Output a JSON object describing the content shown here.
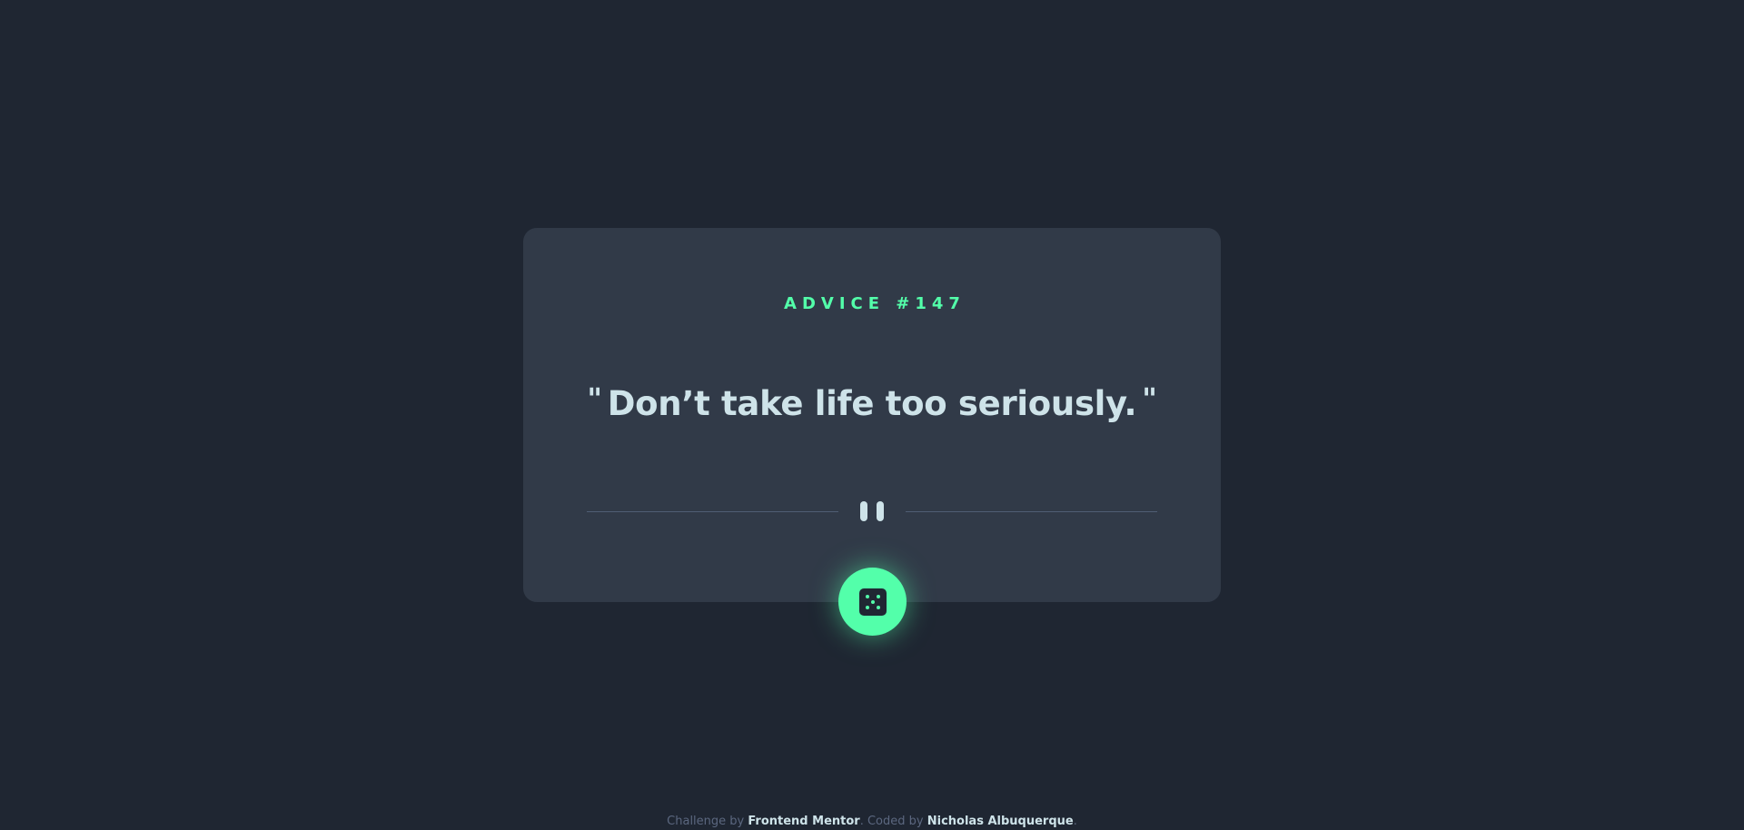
{
  "colors": {
    "background": "#1f2632",
    "card": "#313a48",
    "accent": "#53ffaa",
    "quote_text": "#cee3e9",
    "muted_text": "#5b677f"
  },
  "advice": {
    "heading": "ADVICE #147",
    "quote_open": "\"",
    "text": "Don’t take life too seriously.",
    "quote_close": "\""
  },
  "divider": {
    "icon": "pause-icon"
  },
  "dice_button": {
    "icon": "dice-icon"
  },
  "footer": {
    "challenge_prefix": "Challenge by ",
    "challenge_link": "Frontend Mentor",
    "coded_prefix": ". Coded by ",
    "coder_link": "Nicholas Albuquerque",
    "suffix": "."
  }
}
